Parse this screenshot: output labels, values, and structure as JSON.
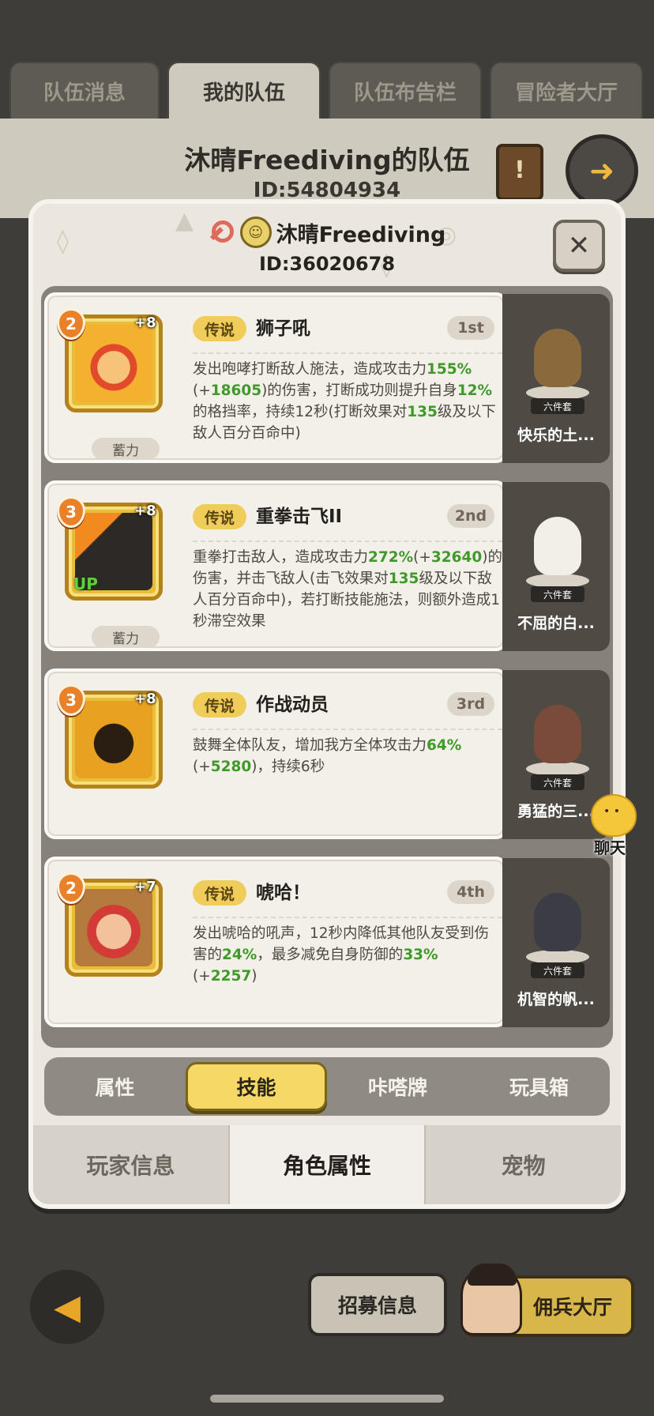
{
  "background": {
    "tabs": [
      {
        "label": "队伍消息",
        "active": false
      },
      {
        "label": "我的队伍",
        "active": true
      },
      {
        "label": "队伍布告栏",
        "active": false
      },
      {
        "label": "冒险者大厅",
        "active": false
      }
    ],
    "team_title": "沐晴Freediving的队伍",
    "team_id": "ID:54804934",
    "scroll_glyph": "!",
    "recruit_label": "招募信息",
    "mercenary_label": "佣兵大厅"
  },
  "modal": {
    "player_name": "沐晴Freediving",
    "player_id": "ID:36020678",
    "close_glyph": "✕",
    "skills": [
      {
        "level": "2",
        "plus": "+8",
        "rarity": "传说",
        "name": "狮子吼",
        "order": "1st",
        "tag": "蓄力",
        "up": "",
        "desc": [
          {
            "t": "发出咆哮打断敌人施法，造成攻击力",
            "g": false
          },
          {
            "t": "155%",
            "g": true
          },
          {
            "t": "(+",
            "g": false
          },
          {
            "t": "18605",
            "g": true
          },
          {
            "t": ")的伤害，打断成功则提升自身",
            "g": false
          },
          {
            "t": "12%",
            "g": true
          },
          {
            "t": "的格挡率，持续12秒(打断效果对",
            "g": false
          },
          {
            "t": "135",
            "g": true
          },
          {
            "t": "级及以下敌人百分百命中)",
            "g": false
          }
        ],
        "pet": {
          "name": "快乐的土...",
          "set": "六件套",
          "color": "#8a6a3c"
        }
      },
      {
        "level": "3",
        "plus": "+8",
        "rarity": "传说",
        "name": "重拳击飞II",
        "order": "2nd",
        "tag": "蓄力",
        "up": "UP",
        "desc": [
          {
            "t": "重拳打击敌人，造成攻击力",
            "g": false
          },
          {
            "t": "272%",
            "g": true
          },
          {
            "t": "(+",
            "g": false
          },
          {
            "t": "32640",
            "g": true
          },
          {
            "t": ")的伤害，并击飞敌人(击飞效果对",
            "g": false
          },
          {
            "t": "135",
            "g": true
          },
          {
            "t": "级及以下敌人百分百命中)，若打断技能施法，则额外造成1秒滞空效果",
            "g": false
          }
        ],
        "pet": {
          "name": "不屈的白...",
          "set": "六件套",
          "color": "#f2efe8"
        }
      },
      {
        "level": "3",
        "plus": "+8",
        "rarity": "传说",
        "name": "作战动员",
        "order": "3rd",
        "tag": "",
        "up": "",
        "desc": [
          {
            "t": "鼓舞全体队友，增加我方全体攻击力",
            "g": false
          },
          {
            "t": "64%",
            "g": true
          },
          {
            "t": "(+",
            "g": false
          },
          {
            "t": "5280",
            "g": true
          },
          {
            "t": ")，持续6秒",
            "g": false
          }
        ],
        "pet": {
          "name": "勇猛的三...",
          "set": "六件套",
          "color": "#7a4a3a"
        }
      },
      {
        "level": "2",
        "plus": "+7",
        "rarity": "传说",
        "name": "唬哈！",
        "order": "4th",
        "tag": "",
        "up": "",
        "desc": [
          {
            "t": "发出唬哈的吼声，12秒内降低其他队友受到伤害的",
            "g": false
          },
          {
            "t": "24%",
            "g": true
          },
          {
            "t": "，最多减免自身防御的",
            "g": false
          },
          {
            "t": "33%",
            "g": true
          },
          {
            "t": "(+",
            "g": false
          },
          {
            "t": "2257",
            "g": true
          },
          {
            "t": ")",
            "g": false
          }
        ],
        "pet": {
          "name": "机智的帆...",
          "set": "六件套",
          "color": "#3c3d44"
        }
      }
    ],
    "sub_tabs": [
      {
        "label": "属性",
        "active": false
      },
      {
        "label": "技能",
        "active": true
      },
      {
        "label": "咔嗒牌",
        "active": false
      },
      {
        "label": "玩具箱",
        "active": false
      }
    ],
    "bottom_tabs": [
      {
        "label": "玩家信息",
        "active": false
      },
      {
        "label": "角色属性",
        "active": true
      },
      {
        "label": "宠物",
        "active": false
      }
    ]
  },
  "chat": {
    "label": "聊天"
  },
  "colors": {
    "green_value": "#3f9a2a",
    "gold_pill": "#f0cd5a",
    "active_tab": "#f6d866"
  }
}
